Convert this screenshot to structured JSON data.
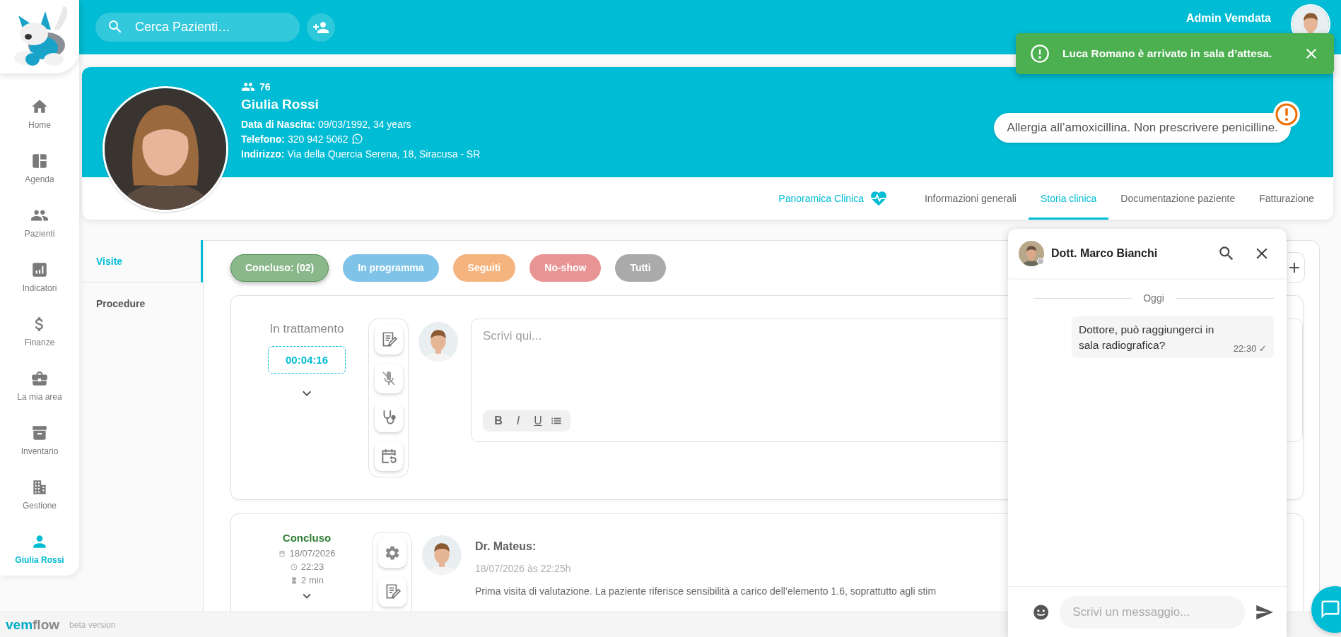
{
  "topbar": {
    "search_placeholder": "Cerca Pazienti…",
    "user_name": "Admin Vemdata"
  },
  "sidebar": {
    "items": [
      {
        "label": "Home",
        "kind": "home",
        "selected": false
      },
      {
        "label": "Agenda",
        "kind": "agenda",
        "selected": false
      },
      {
        "label": "Pazienti",
        "kind": "patients",
        "selected": false
      },
      {
        "label": "Indicatori",
        "kind": "indicators",
        "selected": false
      },
      {
        "label": "Finanze",
        "kind": "finance",
        "selected": false
      },
      {
        "label": "La mia area",
        "kind": "area",
        "selected": false
      },
      {
        "label": "Inventario",
        "kind": "inventory",
        "selected": false
      },
      {
        "label": "Gestione",
        "kind": "management",
        "selected": false
      },
      {
        "label": "Giulia Rossi",
        "kind": "person",
        "selected": true
      }
    ]
  },
  "toast": {
    "message": "Luca Romano è arrivato in sala d’attesa."
  },
  "patient": {
    "count": "76",
    "name": "Giulia Rossi",
    "fields": [
      {
        "label": "Data di Nascita:",
        "value": "09/03/1992, 34 years"
      },
      {
        "label": "Telefono:",
        "value": "320 942 5062",
        "whatsapp": true
      },
      {
        "label": "Indirizzo:",
        "value": "Via della Quercia Serena, 18, Siracusa - SR"
      }
    ],
    "alert": "Allergia all’amoxicillina. Non prescrivere penicilline."
  },
  "tabs": [
    {
      "label": "Panoramica Clinica",
      "kind": "overview",
      "selected": false
    },
    {
      "label": "Informazioni generali",
      "kind": "plain",
      "selected": false
    },
    {
      "label": "Storia clinica",
      "kind": "plain",
      "selected": true
    },
    {
      "label": "Documentazione paziente",
      "kind": "plain",
      "selected": false
    },
    {
      "label": "Fatturazione",
      "kind": "plain",
      "selected": false
    }
  ],
  "subnav": [
    {
      "label": "Visite",
      "selected": true
    },
    {
      "label": "Procedure",
      "selected": false
    }
  ],
  "filters": [
    {
      "label": "Concluso: (02)",
      "color": "#8ab88a",
      "selected": true
    },
    {
      "label": "In programma",
      "color": "#7fc3e8",
      "selected": false
    },
    {
      "label": "Seguiti",
      "color": "#f5b47e",
      "selected": false
    },
    {
      "label": "No-show",
      "color": "#e89494",
      "selected": false
    },
    {
      "label": "Tutti",
      "color": "#aaaaaa",
      "selected": false
    }
  ],
  "visits": [
    {
      "kind": "active",
      "status": "In trattamento",
      "timer": "00:04:16",
      "placeholder": "Scrivi qui...",
      "format_buttons": [
        "B",
        "I",
        "U"
      ]
    },
    {
      "kind": "done",
      "status": "Concluso",
      "date": "18/07/2026",
      "time": "22:23",
      "duration": "2 min",
      "author": "Dr. Mateus:",
      "timestamp": "18/07/2026 às 22:25h",
      "note": "Prima visita di valutazione. La paziente riferisce sensibilità a carico dell’elemento 1.6, soprattutto agli stim"
    }
  ],
  "chat": {
    "contact": "Dott. Marco Bianchi",
    "online": false,
    "day": "Oggi",
    "messages": [
      {
        "text": "Dottore, può raggiungerci in sala radiografica?",
        "time": "22:30",
        "mark": "✓"
      }
    ],
    "placeholder": "Scrivi un messaggio..."
  },
  "footer": {
    "brand": [
      "vem",
      "flow"
    ],
    "note": "beta version"
  }
}
